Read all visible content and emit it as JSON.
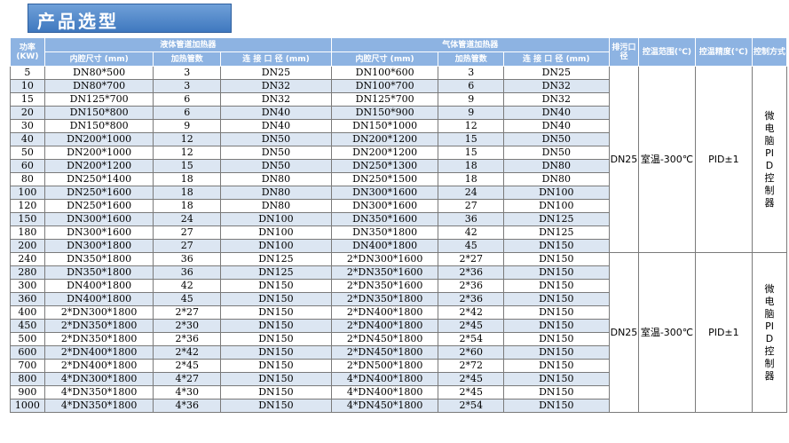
{
  "title": "产品选型",
  "headers": {
    "power": "功率\n(KW)",
    "liquid_group": "液体管道加热器",
    "gas_group": "气体管道加热器",
    "drain": "排污口径",
    "temp_range": "控温范围(℃)",
    "temp_precision": "控温精度(℃)",
    "control_mode": "控制方式",
    "inner_size": "内腔尺寸 (mm)",
    "heat_tubes": "加热管数",
    "conn_size": "连 接 口 径 (mm)"
  },
  "rows": [
    [
      "5",
      "DN80*500",
      "3",
      "DN25",
      "DN100*600",
      "3",
      "DN25"
    ],
    [
      "10",
      "DN80*700",
      "3",
      "DN32",
      "DN100*700",
      "6",
      "DN32"
    ],
    [
      "15",
      "DN125*700",
      "6",
      "DN32",
      "DN125*700",
      "9",
      "DN32"
    ],
    [
      "20",
      "DN150*800",
      "6",
      "DN40",
      "DN150*900",
      "9",
      "DN40"
    ],
    [
      "30",
      "DN150*800",
      "9",
      "DN40",
      "DN150*1000",
      "12",
      "DN40"
    ],
    [
      "40",
      "DN200*1000",
      "12",
      "DN50",
      "DN200*1200",
      "15",
      "DN50"
    ],
    [
      "50",
      "DN200*1000",
      "12",
      "DN50",
      "DN200*1200",
      "15",
      "DN50"
    ],
    [
      "60",
      "DN200*1200",
      "15",
      "DN50",
      "DN250*1300",
      "18",
      "DN80"
    ],
    [
      "80",
      "DN250*1400",
      "18",
      "DN80",
      "DN250*1500",
      "18",
      "DN80"
    ],
    [
      "100",
      "DN250*1600",
      "18",
      "DN80",
      "DN300*1600",
      "24",
      "DN100"
    ],
    [
      "120",
      "DN250*1600",
      "18",
      "DN80",
      "DN300*1600",
      "27",
      "DN100"
    ],
    [
      "150",
      "DN300*1600",
      "24",
      "DN100",
      "DN350*1600",
      "36",
      "DN125"
    ],
    [
      "180",
      "DN300*1600",
      "27",
      "DN100",
      "DN350*1800",
      "42",
      "DN125"
    ],
    [
      "200",
      "DN300*1800",
      "27",
      "DN100",
      "DN400*1800",
      "45",
      "DN150"
    ],
    [
      "240",
      "DN350*1800",
      "36",
      "DN125",
      "2*DN300*1600",
      "2*27",
      "DN150"
    ],
    [
      "280",
      "DN350*1800",
      "36",
      "DN125",
      "2*DN350*1600",
      "2*36",
      "DN150"
    ],
    [
      "300",
      "DN400*1800",
      "42",
      "DN150",
      "2*DN350*1600",
      "2*36",
      "DN150"
    ],
    [
      "360",
      "DN400*1800",
      "45",
      "DN150",
      "2*DN350*1800",
      "2*36",
      "DN150"
    ],
    [
      "400",
      "2*DN300*1800",
      "2*27",
      "DN150",
      "2*DN400*1800",
      "2*42",
      "DN150"
    ],
    [
      "450",
      "2*DN350*1800",
      "2*30",
      "DN150",
      "2*DN400*1800",
      "2*45",
      "DN150"
    ],
    [
      "500",
      "2*DN350*1800",
      "2*36",
      "DN150",
      "2*DN450*1800",
      "2*54",
      "DN150"
    ],
    [
      "600",
      "2*DN400*1800",
      "2*42",
      "DN150",
      "2*DN450*1800",
      "2*60",
      "DN150"
    ],
    [
      "700",
      "2*DN400*1800",
      "2*45",
      "DN150",
      "2*DN500*1800",
      "2*72",
      "DN150"
    ],
    [
      "800",
      "4*DN300*1800",
      "4*27",
      "DN150",
      "4*DN400*1800",
      "2*45",
      "DN150"
    ],
    [
      "900",
      "4*DN350*1800",
      "4*30",
      "DN150",
      "4*DN400*1800",
      "2*45",
      "DN150"
    ],
    [
      "1000",
      "4*DN350*1800",
      "4*36",
      "DN150",
      "4*DN450*1800",
      "2*54",
      "DN150"
    ]
  ],
  "groups": [
    {
      "drain": "DN25",
      "temp_range": "室温-300℃",
      "temp_precision": "PID±1",
      "control_mode": "微电脑PID控制器"
    },
    {
      "drain": "DN25",
      "temp_range": "室温-300℃",
      "temp_precision": "PID±1",
      "control_mode": "微电脑PID控制器"
    }
  ],
  "colors": {
    "header_bg": "#8db3e2",
    "title_bg": "#3f78bf",
    "row_alt": "#dce6f2"
  }
}
